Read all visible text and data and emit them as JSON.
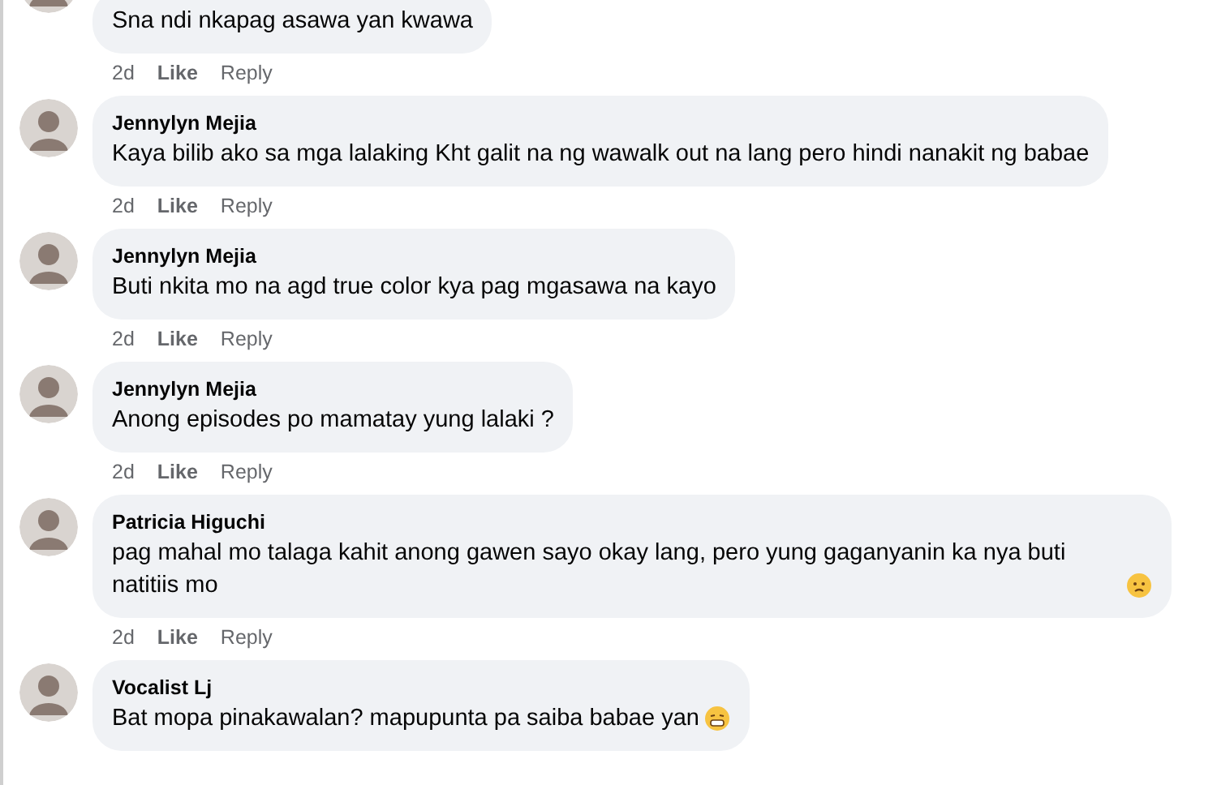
{
  "comments": [
    {
      "text": "Sna ndi nkapag asawa yan kwawa",
      "time": "2d",
      "like": "Like",
      "reply": "Reply"
    },
    {
      "author": "Jennylyn Mejia",
      "text": "Kaya bilib ako sa mga lalaking Kht galit na ng wawalk out na lang pero hindi nanakit ng babae",
      "time": "2d",
      "like": "Like",
      "reply": "Reply"
    },
    {
      "author": "Jennylyn Mejia",
      "text": "Buti nkita mo na agd true color kya pag mgasawa na kayo",
      "time": "2d",
      "like": "Like",
      "reply": "Reply"
    },
    {
      "author": "Jennylyn Mejia",
      "text": "Anong episodes po mamatay yung lalaki ?",
      "time": "2d",
      "like": "Like",
      "reply": "Reply"
    },
    {
      "author": "Patricia Higuchi",
      "text": "pag mahal mo talaga kahit anong gawen sayo okay lang, pero yung gaganyanin ka nya buti natitiis mo",
      "emoji": {
        "kind": "frown"
      },
      "time": "2d",
      "like": "Like",
      "reply": "Reply"
    },
    {
      "author": "Vocalist Lj",
      "text": "Bat mopa pinakawalan? mapupunta pa saiba babae yan",
      "emoji": {
        "kind": "grimace"
      }
    }
  ]
}
